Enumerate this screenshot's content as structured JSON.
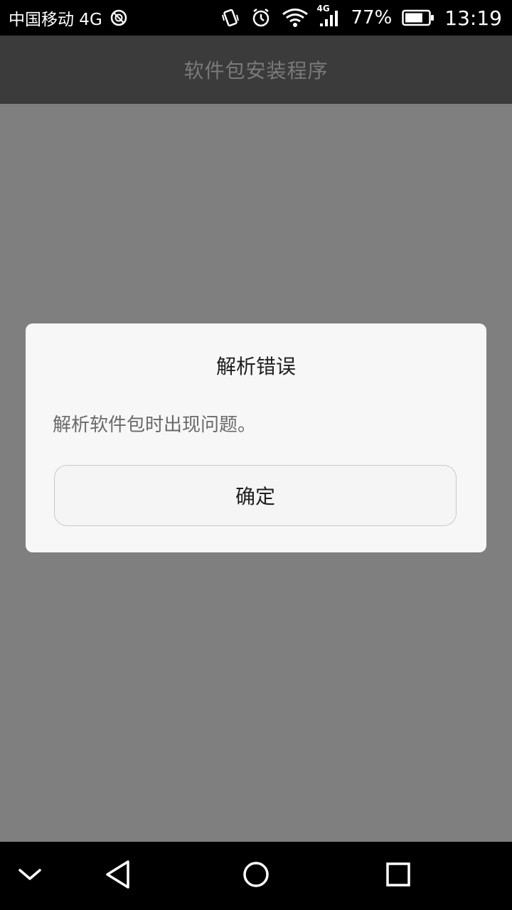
{
  "status_bar": {
    "carrier": "中国移动 4G",
    "network_type_badge": "4G",
    "battery_percent": "77%",
    "battery_level": 0.77,
    "time": "13:19",
    "icons": [
      "data-saver-icon",
      "vibrate-icon",
      "alarm-icon",
      "wifi-icon",
      "signal-icon",
      "battery-icon"
    ]
  },
  "app": {
    "title": "软件包安装程序"
  },
  "dialog": {
    "title": "解析错误",
    "message": "解析软件包时出现问题。",
    "ok_label": "确定"
  },
  "nav_bar": {
    "icons": [
      "collapse-icon",
      "back-icon",
      "home-icon",
      "recents-icon"
    ]
  },
  "colors": {
    "status_bar_bg": "#000000",
    "title_bar_bg": "#3b3b3b",
    "overlay_bg": "#7f7f7f",
    "dialog_bg": "#f7f7f7",
    "nav_bar_bg": "#000000"
  }
}
